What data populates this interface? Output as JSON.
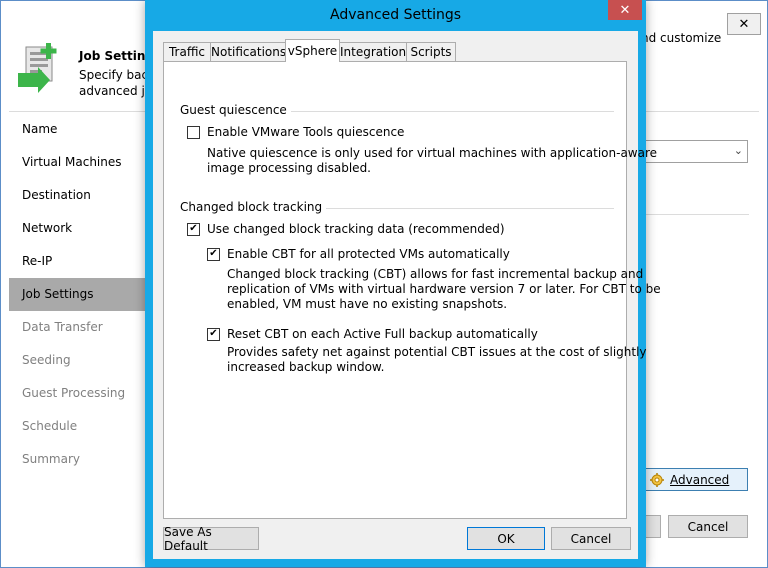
{
  "wizard": {
    "close_glyph": "✕",
    "header": {
      "title": "Job Settings",
      "desc_lines": [
        "Specify back",
        "advanced job"
      ],
      "desc_right": "nd customize"
    },
    "steps": [
      {
        "label": "Name",
        "state": "normal"
      },
      {
        "label": "Virtual Machines",
        "state": "normal"
      },
      {
        "label": "Destination",
        "state": "normal"
      },
      {
        "label": "Network",
        "state": "normal"
      },
      {
        "label": "Re-IP",
        "state": "normal"
      },
      {
        "label": "Job Settings",
        "state": "active"
      },
      {
        "label": "Data Transfer",
        "state": "disabled"
      },
      {
        "label": "Seeding",
        "state": "disabled"
      },
      {
        "label": "Guest Processing",
        "state": "disabled"
      },
      {
        "label": "Schedule",
        "state": "disabled"
      },
      {
        "label": "Summary",
        "state": "disabled"
      }
    ],
    "advanced_label": "Advanced",
    "cancel_label": "Cancel"
  },
  "dialog": {
    "title": "Advanced Settings",
    "close_glyph": "✕",
    "tabs": [
      {
        "label": "Traffic",
        "active": false
      },
      {
        "label": "Notifications",
        "active": false
      },
      {
        "label": "vSphere",
        "active": true
      },
      {
        "label": "Integration",
        "active": false
      },
      {
        "label": "Scripts",
        "active": false
      }
    ],
    "guest_quiescence": {
      "group_label": "Guest quiescence",
      "vmware_tools": {
        "label": "Enable VMware Tools quiescence",
        "checked": false,
        "desc_lines": [
          "Native quiescence is only used for virtual machines with application-aware",
          "image processing disabled."
        ]
      }
    },
    "cbt": {
      "group_label": "Changed block tracking",
      "use_cbt": {
        "label": "Use changed block tracking data (recommended)",
        "checked": true
      },
      "enable_cbt": {
        "label": "Enable CBT for all protected VMs automatically",
        "checked": true,
        "desc_lines": [
          "Changed block tracking (CBT) allows for fast incremental backup and",
          "replication of VMs with virtual hardware version 7 or later. For CBT to be",
          "enabled, VM must have no existing snapshots."
        ]
      },
      "reset_cbt": {
        "label": "Reset CBT on each Active Full backup automatically",
        "checked": true,
        "desc_lines": [
          "Provides safety net against potential CBT issues at the cost of slightly",
          "increased backup window."
        ]
      }
    },
    "buttons": {
      "save_default": "Save As Default",
      "ok": "OK",
      "cancel": "Cancel"
    },
    "colors": {
      "title_bar": "#17a9e6",
      "close_button": "#c75050"
    }
  }
}
